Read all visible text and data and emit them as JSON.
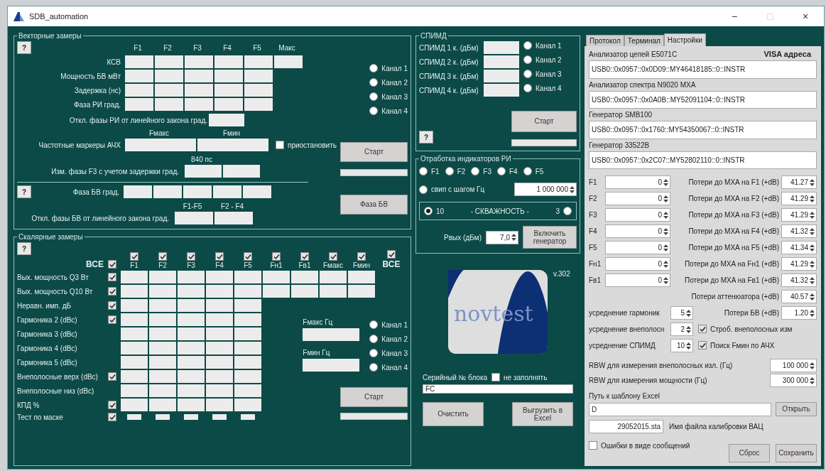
{
  "window": {
    "title": "SDB_automation",
    "controls": [
      {
        "label": "−",
        "disabled": false
      },
      {
        "label": "□",
        "disabled": true
      },
      {
        "label": "×",
        "disabled": false
      }
    ]
  },
  "vector": {
    "title": "Векторные замеры",
    "help": "?",
    "headers": [
      "F1",
      "F2",
      "F3",
      "F4",
      "F5",
      "Макс"
    ],
    "rows": [
      {
        "label": "КСВ",
        "kind": "with_max"
      },
      {
        "label": "Мощность БВ мВт",
        "kind": "five"
      },
      {
        "label": "Задержка (нс)",
        "kind": "five"
      },
      {
        "label": "Фаза РИ град.",
        "kind": "five"
      }
    ],
    "deviation": {
      "label": "Откл. фазы РИ от линейного закона град."
    },
    "markers": {
      "label": "Частотные маркеры АЧХ",
      "headers": [
        "Fмакс",
        "Fмин"
      ],
      "pause": {
        "label": "приостановить",
        "checked": false
      }
    },
    "delay_phase": {
      "note": "840 пс",
      "label": "Изм. фазы F3 с учетом задержки град."
    },
    "channels": [
      {
        "label": "Канал 1",
        "selected": false
      },
      {
        "label": "Канал 2",
        "selected": false
      },
      {
        "label": "Канал 3",
        "selected": false
      },
      {
        "label": "Канал 4",
        "selected": false
      }
    ],
    "start": "Старт",
    "progress": {
      "level": 0
    },
    "bb": {
      "help": "?",
      "label": "Фаза БВ град.",
      "dev_headers": [
        "F1-F5",
        "F2 - F4"
      ],
      "dev_label": "Откл. фазы БВ от линейного закона град.",
      "button": "Фаза БВ"
    }
  },
  "scalar": {
    "title": "Скалярные замеры",
    "help": "?",
    "all": {
      "label": "ВСЕ",
      "checked": true
    },
    "columns": [
      {
        "label": "F1",
        "checked": true
      },
      {
        "label": "F2",
        "checked": true
      },
      {
        "label": "F3",
        "checked": true
      },
      {
        "label": "F4",
        "checked": true
      },
      {
        "label": "F5",
        "checked": true
      },
      {
        "label": "Fн1",
        "checked": true
      },
      {
        "label": "Fв1",
        "checked": true
      },
      {
        "label": "Fмакс",
        "checked": true
      },
      {
        "label": "Fмин",
        "checked": true
      },
      {
        "label": "ВСЕ",
        "checked": true
      }
    ],
    "rows": [
      {
        "label": "Вых. мощность Q3  Вт",
        "checked": true,
        "kind": "wide"
      },
      {
        "label": "Вых. мощность Q10 Вт",
        "checked": true,
        "kind": "wide"
      },
      {
        "label": "Неравн. имп. дБ",
        "checked": true,
        "kind": "narrow"
      },
      {
        "label": "Гармоника 2 (dBc)",
        "checked": true,
        "kind": "narrow"
      },
      {
        "label": "Гармоника 3 (dBc)",
        "kind": "narrow"
      },
      {
        "label": "Гармоника 4 (dBc)",
        "kind": "narrow"
      },
      {
        "label": "Гармоника 5 (dBc)",
        "kind": "narrow"
      },
      {
        "label": "Внеполосные верх (dBc)",
        "checked": true,
        "kind": "narrow"
      },
      {
        "label": "Внеполосные низ  (dBc)",
        "kind": "narrow"
      },
      {
        "label": "КПД %",
        "checked": true,
        "kind": "narrow"
      },
      {
        "label": "Тест по маске",
        "checked": true,
        "kind": "mask"
      }
    ],
    "fmax": {
      "label": "Fмакс Гц"
    },
    "fmin": {
      "label": "Fмин Гц"
    },
    "channels": [
      {
        "label": "Канал 1",
        "selected": false
      },
      {
        "label": "Канал 2",
        "selected": false
      },
      {
        "label": "Канал 3",
        "selected": false
      },
      {
        "label": "Канал 4",
        "selected": false
      }
    ],
    "start": "Старт",
    "progress": {
      "level": 0
    }
  },
  "spimd": {
    "title": "СПИМД",
    "rows": [
      {
        "label": "СПИМД 1 к. (дБм)"
      },
      {
        "label": "СПИМД 2 к. (дБм)"
      },
      {
        "label": "СПИМД 3 к. (дБм)"
      },
      {
        "label": "СПИМД 4 к. (дБм)"
      }
    ],
    "channels": [
      {
        "label": "Канал 1",
        "selected": false
      },
      {
        "label": "Канал 2",
        "selected": false
      },
      {
        "label": "Канал 3",
        "selected": false
      },
      {
        "label": "Канал 4",
        "selected": false
      }
    ],
    "start": "Старт",
    "help": "?",
    "progress": {
      "level": 0
    }
  },
  "ri": {
    "title": "Отработка индикаторов РИ",
    "freqs": [
      {
        "label": "F1",
        "selected": false
      },
      {
        "label": "F2",
        "selected": false
      },
      {
        "label": "F3",
        "selected": false
      },
      {
        "label": "F4",
        "selected": false
      },
      {
        "label": "F5",
        "selected": false
      }
    ],
    "sweep": {
      "label": "свип с шагом Гц",
      "selected": false,
      "value": "1 000 000"
    },
    "duty": {
      "label": "- СКВАЖНОСТЬ -",
      "options": [
        {
          "label": "10",
          "selected": true
        },
        {
          "label": "3",
          "selected": false
        }
      ]
    },
    "pout": {
      "label": "Pвых (дБм)",
      "value": "7,0"
    },
    "generator_button": "Включить генератор"
  },
  "logo": {
    "text": "novtest",
    "version": "v.302"
  },
  "serial": {
    "label": "Серийный № блока",
    "skip": {
      "label": "не заполнять",
      "checked": false
    },
    "value": "FC"
  },
  "actions": [
    "Очистить",
    "Выгрузить в Excel"
  ],
  "settings": {
    "tabs": [
      {
        "label": "Протокол",
        "selected": false
      },
      {
        "label": "Терминал",
        "selected": false
      },
      {
        "label": "Настройки",
        "selected": true
      }
    ],
    "visa_title": "VISA адреса",
    "devices": [
      {
        "label": "Анализатор цепей E5071C",
        "address": "USB0::0x0957::0x0D09::MY46418185::0::INSTR"
      },
      {
        "label": "Анализатор спектра N9020 MXA",
        "address": "USB0::0x0957::0x0A0B::MY52091104::0::INSTR"
      },
      {
        "label": "Генератор SMB100",
        "address": "USB0::0x0957::0x1760::MY54350067::0::INSTR"
      },
      {
        "label": "Генератор 33522B",
        "address": "USB0::0x0957::0x2C07::MY52802110::0::INSTR"
      }
    ],
    "losses": [
      {
        "label": "F1",
        "value": "0",
        "loss_label": "Потери до MXA на F1 (+dB)",
        "loss": "41.27"
      },
      {
        "label": "F2",
        "value": "0",
        "loss_label": "Потери до MXA на F2 (+dB)",
        "loss": "41.29"
      },
      {
        "label": "F3",
        "value": "0",
        "loss_label": "Потери до MXA на F3 (+dB)",
        "loss": "41.29"
      },
      {
        "label": "F4",
        "value": "0",
        "loss_label": "Потери до MXA на F4 (+dB)",
        "loss": "41.32"
      },
      {
        "label": "F5",
        "value": "0",
        "loss_label": "Потери до MXA на F5 (+dB)",
        "loss": "41.34"
      },
      {
        "label": "Fн1",
        "value": "0",
        "loss_label": "Потери до MXA на Fн1 (+dB)",
        "loss": "41.29"
      },
      {
        "label": "Fв1",
        "value": "0",
        "loss_label": "Потери до MXA на Fв1 (+dB)",
        "loss": "41.32"
      }
    ],
    "attenuator": {
      "label": "Потери аттенюатора (+dB)",
      "value": "40.57"
    },
    "averaging": [
      {
        "label": "усреднение гармоник",
        "value": "5",
        "kind": "loss",
        "extra_label": "Потери БВ (+dB)",
        "extra_value": "1.20"
      },
      {
        "label": "усреднение внеполосн",
        "value": "2",
        "kind": "check",
        "extra_label": "Строб. внеполосных изм",
        "checked": true
      },
      {
        "label": "усреднение СПИМД",
        "value": "10",
        "kind": "check",
        "extra_label": "Поиск Fмин по АЧХ",
        "checked": true
      }
    ],
    "rbw": [
      {
        "label": "RBW для измерения внеполосных изл. (Гц)",
        "value": "100 000"
      },
      {
        "label": "RBW для измерения мощности (Гц)",
        "value": "300 000"
      }
    ],
    "template": {
      "label": "Путь к шаблону Excel",
      "value": "D",
      "button": "Открыть"
    },
    "calibration": {
      "value": "29052015.sta",
      "label": "Имя файла калибровки ВАЦ"
    },
    "errors": {
      "label": "Ошибки в виде сообщений",
      "checked": false
    },
    "buttons": [
      "Сброс",
      "Сохранить"
    ]
  }
}
